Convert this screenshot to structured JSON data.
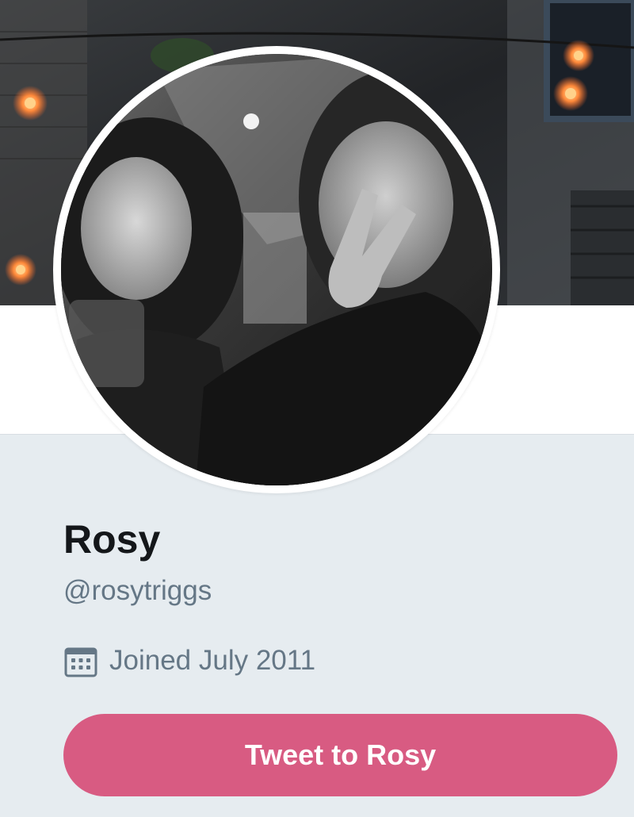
{
  "profile": {
    "display_name": "Rosy",
    "handle": "@rosytriggs",
    "joined_text": "Joined July 2011",
    "joined_icon": "calendar-icon"
  },
  "actions": {
    "tweet_to_label": "Tweet to Rosy"
  },
  "colors": {
    "accent": "#d85b82",
    "page_background": "#e6ecf0",
    "secondary_text": "#657786",
    "primary_text": "#14171a"
  }
}
